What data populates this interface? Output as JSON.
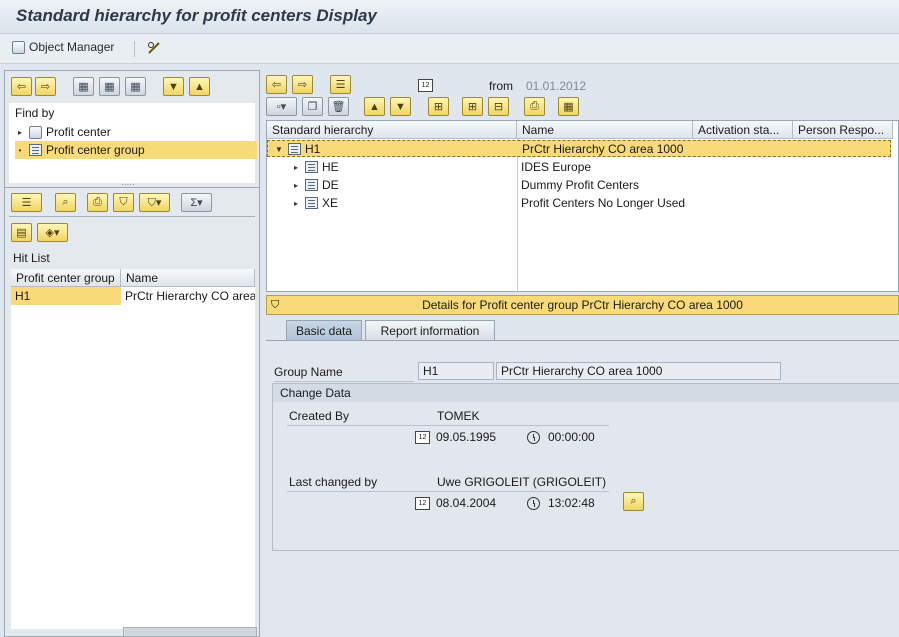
{
  "window": {
    "title": "Standard hierarchy for profit centers Display"
  },
  "menubar": {
    "object_manager": "Object Manager"
  },
  "left": {
    "find_by_label": "Find by",
    "find_by_items": [
      {
        "label": "Profit center",
        "selected": false
      },
      {
        "label": "Profit center group",
        "selected": true
      }
    ],
    "hit_list_label": "Hit List",
    "hit_list_columns": [
      "Profit center group",
      "Name"
    ],
    "hit_list_rows": [
      {
        "group": "H1",
        "name": "PrCtr Hierarchy CO area"
      }
    ]
  },
  "hierarchy": {
    "from_label": "from",
    "from_date": "01.01.2012",
    "columns": [
      "Standard hierarchy",
      "Name",
      "Activation sta...",
      "Person Respo..."
    ],
    "rows": [
      {
        "node": "H1",
        "name": "PrCtr Hierarchy CO area 1000",
        "level": 0,
        "expanded": true,
        "selected": true
      },
      {
        "node": "HE",
        "name": "IDES Europe",
        "level": 1,
        "expanded": false,
        "selected": false
      },
      {
        "node": "DE",
        "name": "Dummy Profit Centers",
        "level": 1,
        "expanded": false,
        "selected": false
      },
      {
        "node": "XE",
        "name": "Profit Centers No Longer Used",
        "level": 1,
        "expanded": false,
        "selected": false
      }
    ]
  },
  "details": {
    "header": "Details for Profit center group PrCtr Hierarchy CO area 1000",
    "tabs": [
      {
        "label": "Basic data",
        "active": true
      },
      {
        "label": "Report information",
        "active": false
      }
    ],
    "group_name_label": "Group Name",
    "group_name_value": "H1",
    "group_name_text": "PrCtr Hierarchy CO area 1000",
    "change_data_label": "Change Data",
    "created_by_label": "Created By",
    "created_by_value": "TOMEK",
    "created_date": "09.05.1995",
    "created_time": "00:00:00",
    "last_changed_label": "Last changed by",
    "last_changed_value": "Uwe GRIGOLEIT (GRIGOLEIT)",
    "changed_date": "08.04.2004",
    "changed_time": "13:02:48"
  },
  "colors": {
    "selection": "#f9da79",
    "button_yellow": "#f1d561",
    "background": "#dfe6ee"
  }
}
